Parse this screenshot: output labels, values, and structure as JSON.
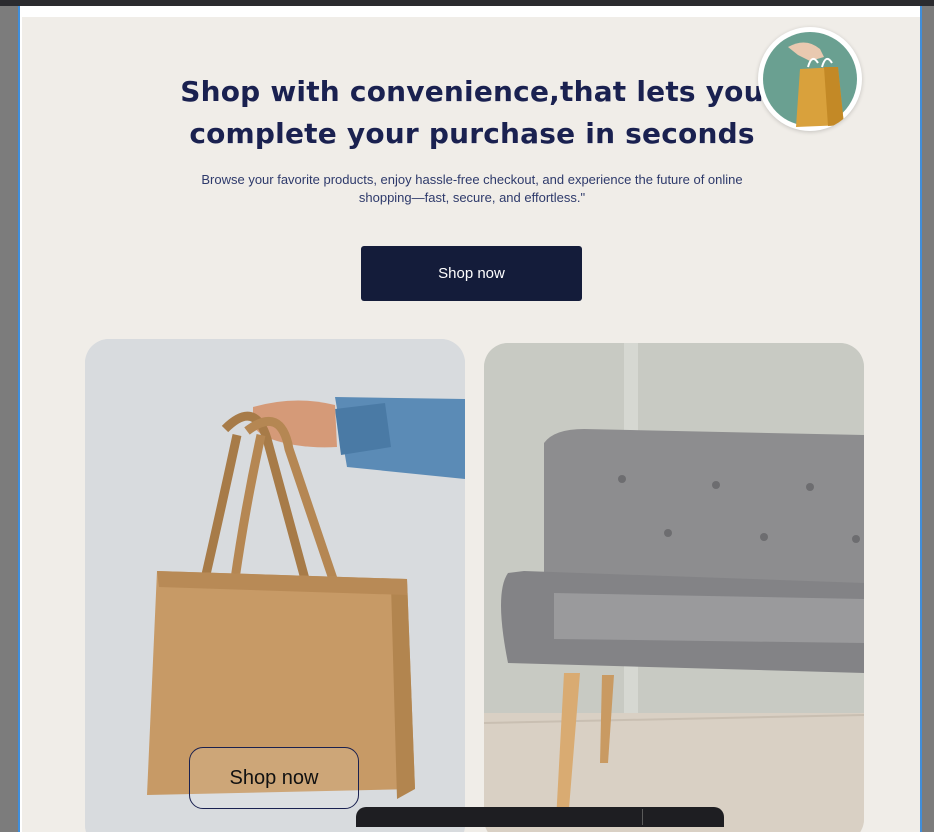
{
  "hero": {
    "title": "Shop with convenience,that lets you complete your purchase in seconds",
    "subtitle": "Browse your favorite products, enjoy hassle-free checkout, and experience the future of online shopping—fast, secure, and effortless.\"",
    "cta_label": "Shop now"
  },
  "cards": {
    "bag": {
      "button_label": "Shop now"
    }
  },
  "colors": {
    "navy": "#141c3a",
    "title": "#1a2150",
    "background": "#f0ede8",
    "frame_border": "#3f8edb"
  },
  "icons": {
    "avatar": "hand-holding-shopping-bag-icon"
  }
}
